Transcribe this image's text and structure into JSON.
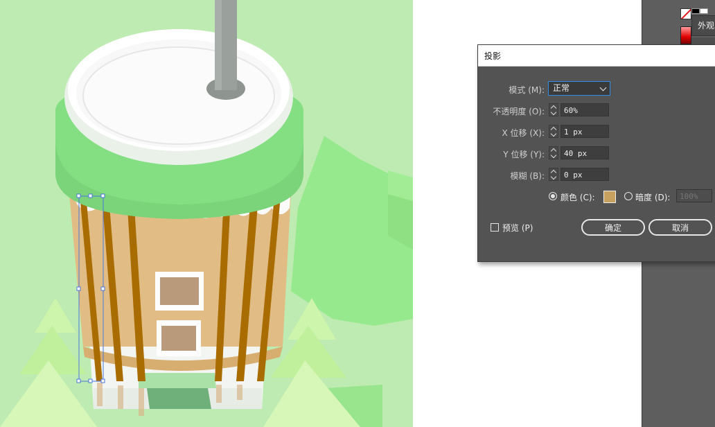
{
  "dialog": {
    "title": "投影",
    "mode_label": "模式 (M):",
    "mode_value": "正常",
    "opacity_label": "不透明度 (O):",
    "opacity_value": "60%",
    "x_offset_label": "X 位移 (X):",
    "x_offset_value": "1 px",
    "y_offset_label": "Y 位移 (Y):",
    "y_offset_value": "40 px",
    "blur_label": "模糊 (B):",
    "blur_value": "0 px",
    "color_option_label": "颜色 (C):",
    "darkness_option_label": "暗度 (D):",
    "darkness_value": "100%",
    "selected_option": "color",
    "shadow_color": "#c7a15f",
    "preview_label": "预览 (P)",
    "preview_checked": false,
    "ok_label": "确定",
    "cancel_label": "取消"
  },
  "panel": {
    "appearance_tab_label": "外观"
  },
  "colors": {
    "artboard_bg": "#bdebb1",
    "cup_green": "#8ad98a",
    "lid_white": "#f7f7f7",
    "sleeve_tan": "#deb97f",
    "stripe_brown": "#a86a00",
    "straw_gray": "#8f9690",
    "tree_light": "#c7f2a0",
    "selection_blue": "#3a6ad8",
    "workspace_dark": "#5e5e5e"
  },
  "icons": [
    "none-swatch-icon",
    "gradient-swatch-icon",
    "chevron-down-icon",
    "spinner-icon",
    "radio-icon",
    "checkbox-icon"
  ]
}
